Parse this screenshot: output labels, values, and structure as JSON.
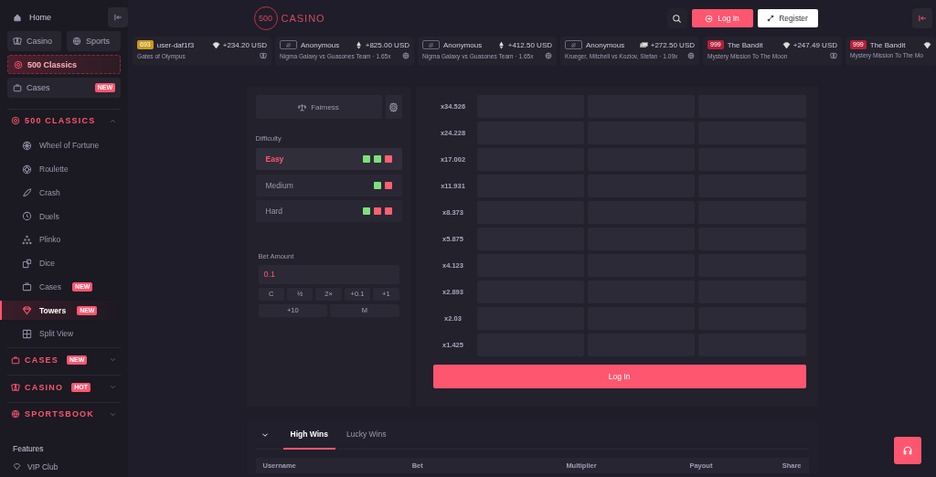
{
  "sidebar": {
    "home": "Home",
    "quick_links": [
      {
        "label": "Casino",
        "selected": false
      },
      {
        "label": "Sports",
        "selected": false
      }
    ],
    "featured": {
      "label": "500 Classics",
      "selected": true
    },
    "cases_link": {
      "label": "Cases",
      "badge": "NEW"
    },
    "sections": [
      {
        "title": "500 CLASSICS",
        "expanded": true,
        "children": [
          {
            "label": "Wheel of Fortune",
            "selected": false
          },
          {
            "label": "Roulette",
            "selected": false
          },
          {
            "label": "Crash",
            "selected": false
          },
          {
            "label": "Duels",
            "selected": false
          },
          {
            "label": "Plinko",
            "selected": false
          },
          {
            "label": "Dice",
            "selected": false
          },
          {
            "label": "Cases",
            "badge": "NEW",
            "selected": false
          },
          {
            "label": "Towers",
            "badge": "NEW",
            "selected": true
          },
          {
            "label": "Split View",
            "selected": false
          }
        ]
      },
      {
        "title": "CASES",
        "badge": "NEW",
        "expanded": false
      },
      {
        "title": "CASINO",
        "badge": "HOT",
        "expanded": false
      },
      {
        "title": "SPORTSBOOK",
        "expanded": false
      }
    ],
    "features_title": "Features",
    "features": [
      {
        "label": "VIP Club"
      }
    ]
  },
  "header": {
    "logo_number": "500",
    "logo_text": "CASINO",
    "login": "Log In",
    "register": "Register"
  },
  "ticker": [
    {
      "badge": {
        "kind": "level",
        "text": "693",
        "color": "#c99a1c"
      },
      "user": "user-daf1f3",
      "coin": {
        "kind": "gem"
      },
      "amount": "+234.20 USD",
      "game": {
        "kind": "casino",
        "text": "Gates of Olympus"
      }
    },
    {
      "badge": {
        "kind": "anonymous"
      },
      "user": "Anonymous",
      "coin": {
        "kind": "eth"
      },
      "amount": "+825.00 USD",
      "game": {
        "kind": "sport",
        "text": "Nigma Galaxy vs Guasones Team · 1.65x"
      }
    },
    {
      "badge": {
        "kind": "anonymous"
      },
      "user": "Anonymous",
      "coin": {
        "kind": "eth"
      },
      "amount": "+412.50 USD",
      "game": {
        "kind": "sport",
        "text": "Nigma Galaxy vs Guasones Team · 1.65x"
      }
    },
    {
      "badge": {
        "kind": "anonymous"
      },
      "user": "Anonymous",
      "coin": {
        "kind": "cash"
      },
      "amount": "+272.50 USD",
      "game": {
        "kind": "sport",
        "text": "Krueger, Mitchell vs Kozlov, Stefan · 1.09x"
      }
    },
    {
      "badge": {
        "kind": "level",
        "text": "999",
        "color": "#b3203a"
      },
      "user": "The Bandit",
      "coin": {
        "kind": "gem"
      },
      "amount": "+247.49 USD",
      "game": {
        "kind": "casino",
        "text": "Mystery Mission To The Moon"
      }
    },
    {
      "badge": {
        "kind": "level",
        "text": "999",
        "color": "#b3203a"
      },
      "user": "The Bandit",
      "coin": {
        "kind": "gem"
      },
      "game": {
        "kind": "cut",
        "text": "Mystery Mission To The Mo"
      }
    }
  ],
  "game": {
    "fairness": "Fairness",
    "difficulty_label": "Difficulty",
    "difficulties": [
      {
        "label": "Easy",
        "selected": true,
        "squares": [
          {
            "kind": "safe"
          },
          {
            "kind": "safe"
          },
          {
            "kind": "mine"
          }
        ]
      },
      {
        "label": "Medium",
        "selected": false,
        "squares": [
          {
            "kind": "safe"
          },
          {
            "kind": "mine"
          }
        ]
      },
      {
        "label": "Hard",
        "selected": false,
        "squares": [
          {
            "kind": "safe"
          },
          {
            "kind": "mine"
          },
          {
            "kind": "mine"
          }
        ]
      }
    ],
    "bet_label": "Bet Amount",
    "bet_value": "0.1",
    "bet_buttons_row1": [
      "C",
      "½",
      "2×",
      "+0.1",
      "+1"
    ],
    "bet_buttons_row2": [
      "+10",
      "M"
    ],
    "multipliers": [
      "x34.526",
      "x24.228",
      "x17.002",
      "x11.931",
      "x8.373",
      "x5.875",
      "x4.123",
      "x2.893",
      "x2.03",
      "x1.425"
    ],
    "login_button": "Log In"
  },
  "wins": {
    "tabs": [
      {
        "label": "High Wins",
        "selected": true
      },
      {
        "label": "Lucky Wins",
        "selected": false
      }
    ],
    "columns": [
      "Username",
      "Bet",
      "Multiplier",
      "Payout",
      "Share"
    ]
  }
}
